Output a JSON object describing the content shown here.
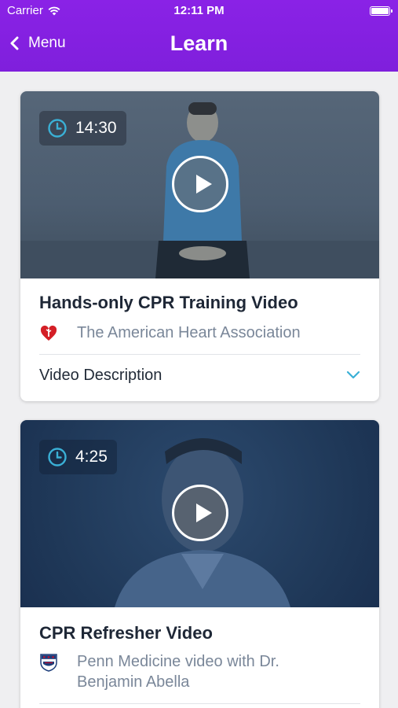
{
  "status_bar": {
    "carrier": "Carrier",
    "time": "12:11 PM",
    "battery_level": 1.0
  },
  "nav": {
    "back_label": "Menu",
    "title": "Learn"
  },
  "colors": {
    "header": "#8a22e6",
    "accent": "#3ab0d6",
    "source_text": "#7a8799"
  },
  "videos": [
    {
      "duration": "14:30",
      "title": "Hands-only CPR Training Video",
      "source": "The American Heart Association",
      "source_icon": "heart-logo-icon",
      "description_label": "Video Description"
    },
    {
      "duration": "4:25",
      "title": "CPR Refresher Video",
      "source": "Penn Medicine video with Dr. Benjamin Abella",
      "source_icon": "penn-shield-logo-icon"
    }
  ]
}
